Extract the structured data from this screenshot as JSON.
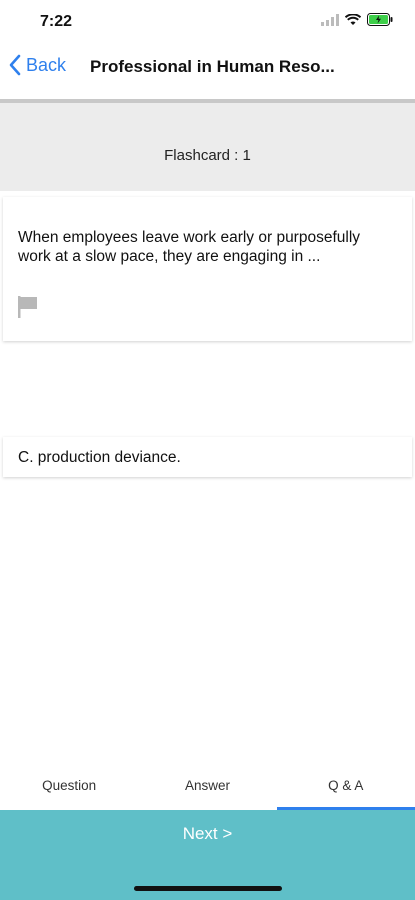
{
  "status_bar": {
    "time": "7:22"
  },
  "nav": {
    "back_label": "Back",
    "title": "Professional in Human Reso..."
  },
  "flashcard": {
    "label": "Flashcard : 1"
  },
  "question": {
    "text": "When employees leave work early or purposefully work at a slow pace, they are engaging in ..."
  },
  "answer": {
    "text": "C. production deviance."
  },
  "tabs": [
    {
      "label": "Question"
    },
    {
      "label": "Answer"
    },
    {
      "label": "Q & A"
    }
  ],
  "footer": {
    "next_label": "Next >"
  },
  "colors": {
    "accent": "#2f80ed",
    "next_bar": "#5fbfc8",
    "header_bg": "#ececec"
  }
}
